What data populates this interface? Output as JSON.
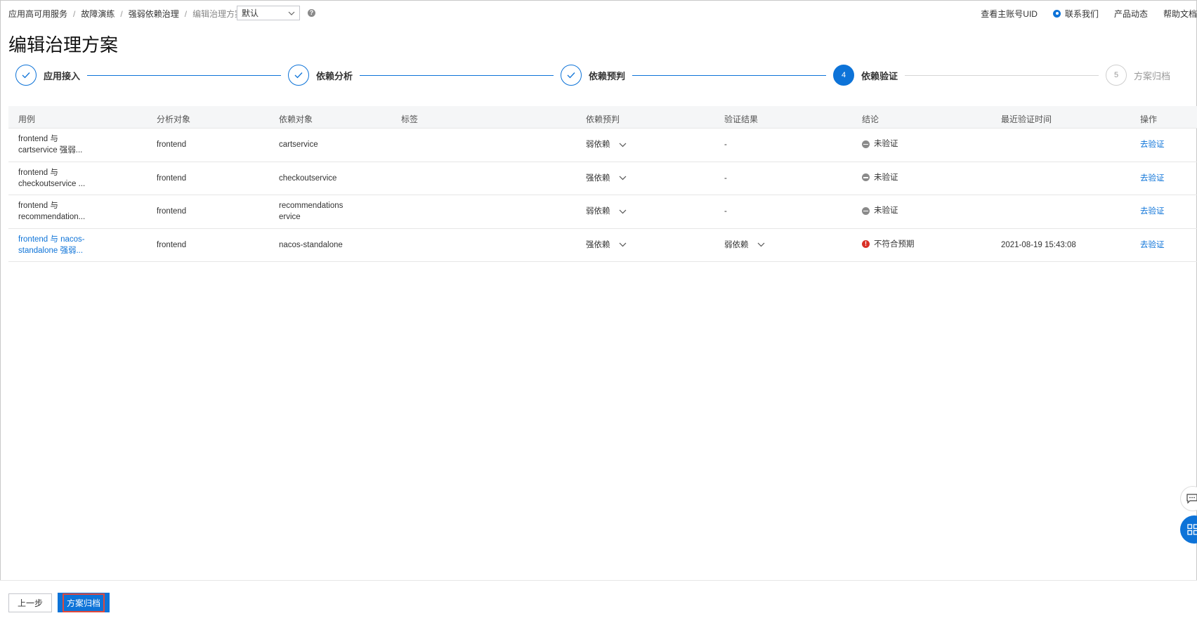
{
  "breadcrumb": [
    "应用高可用服务",
    "故障演练",
    "强弱依赖治理",
    "编辑治理方案"
  ],
  "env_select": {
    "value": "默认"
  },
  "help_icon": "?",
  "top_links": [
    "查看主账号UID",
    "联系我们",
    "产品动态",
    "帮助文档"
  ],
  "page_title": "编辑治理方案",
  "steps": [
    {
      "label": "应用接入",
      "status": "done"
    },
    {
      "label": "依赖分析",
      "status": "done"
    },
    {
      "label": "依赖预判",
      "status": "done"
    },
    {
      "label": "依赖验证",
      "status": "active",
      "number": "4"
    },
    {
      "label": "方案归档",
      "status": "pending",
      "number": "5"
    }
  ],
  "table": {
    "headers": [
      "用例",
      "分析对象",
      "依赖对象",
      "标签",
      "依赖预判",
      "验证结果",
      "结论",
      "最近验证时间",
      "操作"
    ],
    "rows": [
      {
        "usecase_line1": "frontend 与",
        "usecase_line2": "cartservice 强弱...",
        "target": "frontend",
        "dep_line1": "cartservice",
        "dep_line2": "",
        "expect": "弱依赖",
        "result": "-",
        "conclusion": "未验证",
        "time": "",
        "op": "去验证"
      },
      {
        "usecase_line1": "frontend 与",
        "usecase_line2": "checkoutservice ...",
        "target": "frontend",
        "dep_line1": "checkoutservice",
        "dep_line2": "",
        "expect": "强依赖",
        "result": "-",
        "conclusion": "未验证",
        "time": "",
        "op": "去验证"
      },
      {
        "usecase_line1": "frontend 与",
        "usecase_line2": "recommendation...",
        "target": "frontend",
        "dep_line1": "recommendations",
        "dep_line2": "ervice",
        "expect": "弱依赖",
        "result": "-",
        "conclusion": "未验证",
        "time": "",
        "op": "去验证"
      },
      {
        "usecase_line1": "frontend 与 nacos-",
        "usecase_line2": "standalone 强弱...",
        "target": "frontend",
        "dep_line1": "nacos-standalone",
        "dep_line2": "",
        "expect": "强依赖",
        "result": "弱依赖",
        "conclusion": "不符合预期",
        "time": "2021-08-19 15:43:08",
        "op": "去验证"
      }
    ]
  },
  "footer": {
    "prev_label": "上一步",
    "archive_label": "方案归档"
  },
  "colors": {
    "primary": "#0d73d8",
    "error": "#d93026",
    "muted": "#8a8a8a"
  }
}
